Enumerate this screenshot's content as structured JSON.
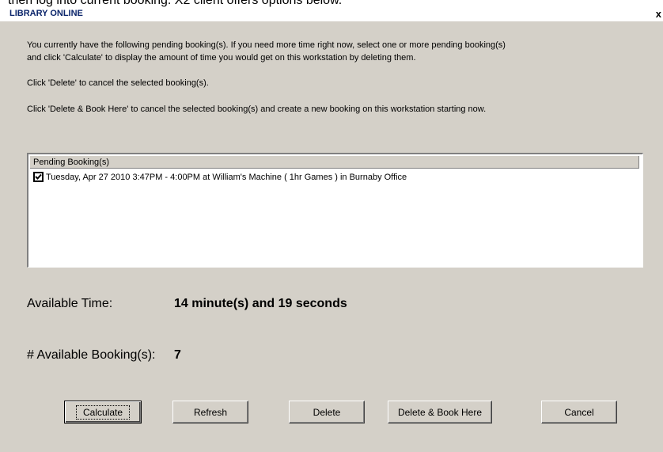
{
  "page_caption": "then log into current booking.   X2 client offers options below.",
  "window": {
    "title": "LIBRARY ONLINE",
    "close_label": "x"
  },
  "instructions": {
    "line1": "You currently have the following pending booking(s). If you need more time right now, select one or more pending booking(s)",
    "line2": "and click 'Calculate' to display the amount of time you would get on this workstation by deleting them.",
    "line3": "Click 'Delete' to cancel the selected booking(s).",
    "line4": "Click 'Delete & Book Here' to cancel the selected booking(s) and create a new booking on this workstation starting now."
  },
  "bookings": {
    "header": "Pending Booking(s)",
    "items": [
      {
        "checked": true,
        "text": "Tuesday, Apr 27 2010  3:47PM -  4:00PM at William's Machine ( 1hr Games ) in Burnaby Office"
      }
    ]
  },
  "available_time": {
    "label": "Available Time:",
    "value": "14 minute(s) and 19 seconds"
  },
  "available_bookings": {
    "label": "# Available Booking(s):",
    "value": "7"
  },
  "buttons": {
    "calculate": "Calculate",
    "refresh": "Refresh",
    "delete": "Delete",
    "delete_book": "Delete & Book Here",
    "cancel": "Cancel"
  }
}
